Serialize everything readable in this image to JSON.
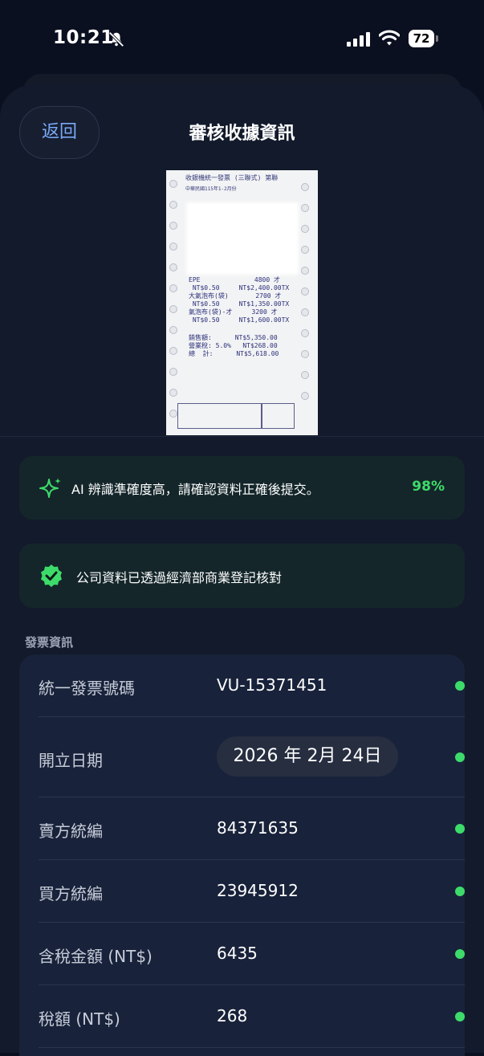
{
  "status": {
    "time": "10:21",
    "battery": "72"
  },
  "header": {
    "back_label": "返回",
    "title": "審核收據資訊"
  },
  "receipt": {
    "heading": "收銀機統一發票 (三聯式) 第聯",
    "lines": [
      "EPE              4800 才",
      " NT$0.50     NT$2,400.00TX",
      "大氣泡布(袋)       2700 才",
      " NT$0.50     NT$1,350.00TX",
      "氣泡布(袋)-才     3200 才",
      " NT$0.50     NT$1,600.00TX",
      "",
      "銷售額:      NT$5,350.00",
      "營業稅: 5.0%   NT$268.00",
      "總  計:      NT$5,618.00"
    ]
  },
  "ai_banner": {
    "text": "AI 辨識準確度高，請確認資料正確後提交。",
    "confidence": "98%"
  },
  "verify_banner": {
    "text": "公司資料已透過經濟部商業登記核對"
  },
  "section": {
    "title": "發票資訊"
  },
  "fields": {
    "invoice_no": {
      "label": "統一發票號碼",
      "value": "VU-15371451"
    },
    "issue_date": {
      "label": "開立日期",
      "value": "2026 年 2月 24日"
    },
    "seller_id": {
      "label": "賣方統編",
      "value": "84371635"
    },
    "buyer_id": {
      "label": "買方統編",
      "value": "23945912"
    },
    "total": {
      "label": "含稅金額 (NT$)",
      "value": "6435"
    },
    "tax": {
      "label": "稅額 (NT$)",
      "value": "268"
    }
  },
  "colors": {
    "accent": "#7aa8f5",
    "success": "#3ddc6a",
    "background": "#0b1020",
    "card": "#18223a"
  },
  "icons": [
    "bell-slash-icon",
    "signal-icon",
    "wifi-icon",
    "battery-icon",
    "sparkle-icon",
    "verified-badge-icon"
  ]
}
